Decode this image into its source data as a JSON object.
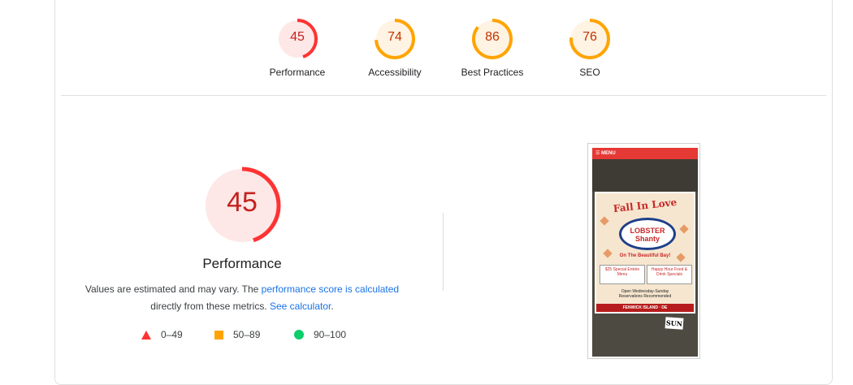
{
  "colors": {
    "fail": "#ff3333",
    "average": "#ffa400",
    "pass": "#0cce6b",
    "fail_text": "#c5221f",
    "average_text": "#c33300",
    "link": "#1a73e8"
  },
  "gauges": [
    {
      "score": "45",
      "label": "Performance",
      "status": "fail"
    },
    {
      "score": "74",
      "label": "Accessibility",
      "status": "average"
    },
    {
      "score": "86",
      "label": "Best Practices",
      "status": "average"
    },
    {
      "score": "76",
      "label": "SEO",
      "status": "average"
    }
  ],
  "performance": {
    "score": "45",
    "title": "Performance",
    "desc_prefix": "Values are estimated and may vary. The ",
    "desc_link1": "performance score is calculated",
    "desc_middle": "directly from these metrics. ",
    "desc_link2": "See calculator",
    "desc_suffix": "."
  },
  "legend": [
    {
      "icon": "triangle-icon",
      "range": "0–49"
    },
    {
      "icon": "square-icon",
      "range": "50–89"
    },
    {
      "icon": "circle-icon",
      "range": "90–100"
    }
  ],
  "screenshot": {
    "menu_label": "☰ MENU",
    "ad_title": "Fall In Love",
    "ad_logo": "LOBSTER Shanty",
    "ad_tag": "On The Beautiful Bay!",
    "box_left": "$25 Special Entrée Menu",
    "box_right": "Happy Hour Food & Drink Specials",
    "bottom_line1": "Open Wednesday-Sunday",
    "bottom_line2": "Reservations Recommended",
    "footer": "FENWICK ISLAND · DE",
    "sun": "SUN"
  }
}
